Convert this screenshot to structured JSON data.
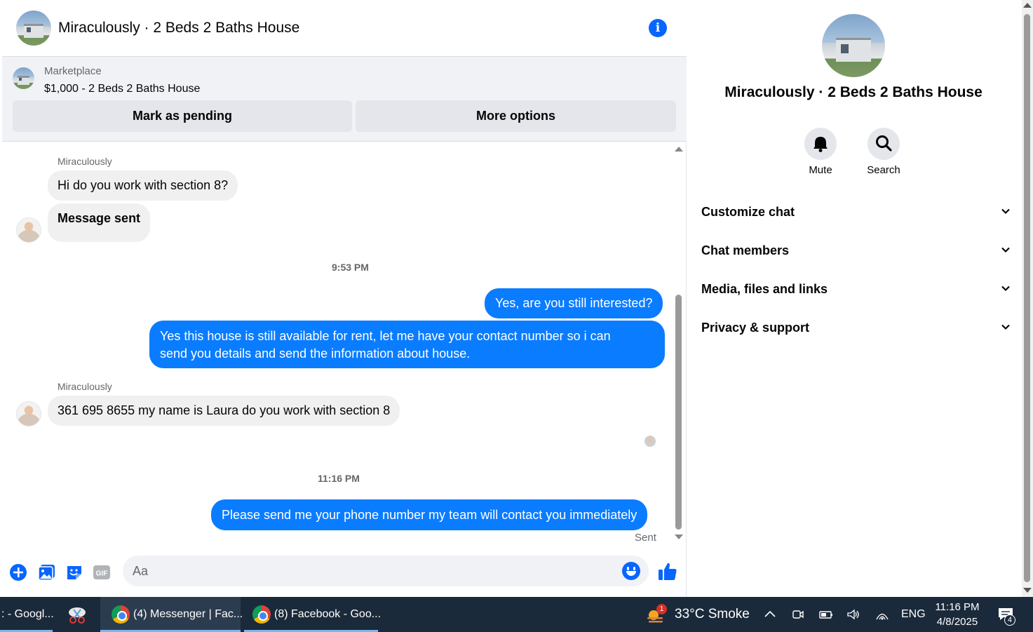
{
  "header": {
    "title": "Miraculously · 2 Beds 2 Baths House",
    "info_icon": "info-icon"
  },
  "marketplace": {
    "label": "Marketplace",
    "price_title": "$1,000 - 2 Beds 2 Baths House",
    "mark_pending_label": "Mark as pending",
    "more_options_label": "More options"
  },
  "messages": {
    "sender_1": "Miraculously",
    "msg_1": "Hi do you work with section 8?",
    "msg_2": "Message sent",
    "time_1": "9:53 PM",
    "out_1": "Yes, are you still interested?",
    "out_2_line1": "Yes this house is still available for rent, let me have your contact number so i can",
    "out_2_line2": "send you details and send the information about house.",
    "sender_2": "Miraculously",
    "msg_3": "361 695 8655 my name is Laura do you work with section 8",
    "time_2": "11:16 PM",
    "out_3": "Please send me your phone number my team will contact you immediately",
    "status": "Sent"
  },
  "composer": {
    "placeholder": "Aa"
  },
  "panel": {
    "title": "Miraculously · 2 Beds 2 Baths House",
    "mute_label": "Mute",
    "search_label": "Search",
    "sections": [
      "Customize chat",
      "Chat members",
      "Media, files and links",
      "Privacy & support"
    ]
  },
  "taskbar": {
    "item_1": ": - Googl...",
    "item_2": "(4) Messenger | Fac...",
    "item_3": "(8) Facebook - Goo...",
    "weather_badge": "1",
    "weather": "33°C  Smoke",
    "lang": "ENG",
    "time": "11:16 PM",
    "date": "4/8/2025",
    "notif_count": "4"
  },
  "colors": {
    "accent": "#0866ff",
    "bubble_out": "#0a7cff",
    "bubble_in": "#f0f0f0",
    "taskbar": "#1b2a3b"
  }
}
